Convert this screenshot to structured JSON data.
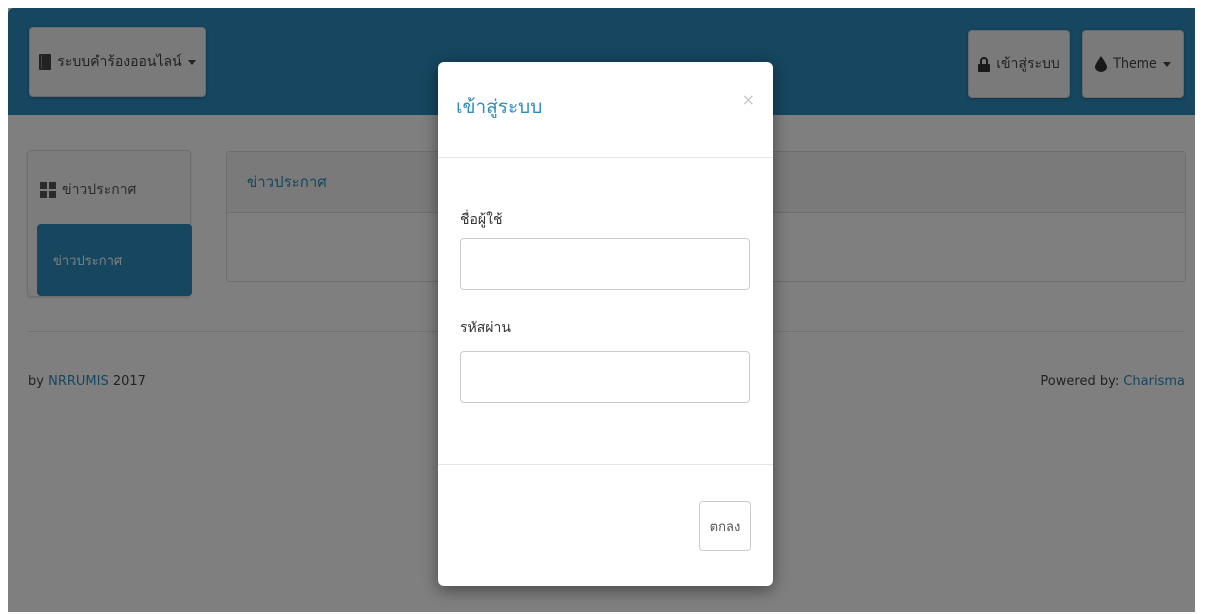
{
  "navbar": {
    "brand_label": "ระบบคำร้องออนไลน์",
    "login_label": "เข้าสู่ระบบ",
    "theme_label": "Theme",
    "brand_icon": "book-icon",
    "login_icon": "lock-icon",
    "theme_icon": "droplet-icon"
  },
  "sidebar": {
    "header": "ข่าวประกาศ",
    "items": [
      {
        "label": "ข่าวประกาศ"
      }
    ]
  },
  "panel": {
    "title": "ข่าวประกาศ"
  },
  "footer": {
    "left_prefix": "by",
    "left_link": "NRRUMIS",
    "left_suffix": "2017",
    "right_prefix": "Powered by:",
    "right_link": "Charisma"
  },
  "modal": {
    "title": "เข้าสู่ระบบ",
    "close": "×",
    "username_label": "ชื่อผู้ใช้",
    "username_value": "",
    "password_label": "รหัสผ่าน",
    "password_value": "",
    "submit_label": "ตกลง"
  },
  "colors": {
    "accent": "#2c8dc0",
    "backdrop": "#000000"
  }
}
